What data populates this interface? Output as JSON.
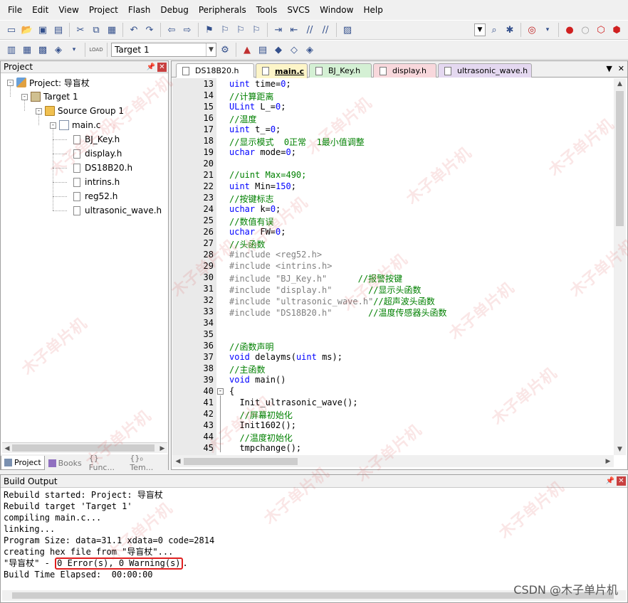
{
  "menu": [
    "File",
    "Edit",
    "View",
    "Project",
    "Flash",
    "Debug",
    "Peripherals",
    "Tools",
    "SVCS",
    "Window",
    "Help"
  ],
  "toolbar2": {
    "target_select": "Target 1",
    "load_label": "LOAD"
  },
  "project_panel": {
    "title": "Project",
    "tree": {
      "project": "Project: 导盲杖",
      "target": "Target 1",
      "group": "Source Group 1",
      "main_file": "main.c",
      "headers": [
        "BJ_Key.h",
        "display.h",
        "DS18B20.h",
        "intrins.h",
        "reg52.h",
        "ultrasonic_wave.h"
      ]
    },
    "tabs": [
      "Project",
      "Books",
      "{} Func...",
      "{}₀ Tem..."
    ]
  },
  "editor": {
    "tabs": [
      {
        "label": "DS18B20.h",
        "color": "#ffffff"
      },
      {
        "label": "main.c",
        "color": "#fdf5c8"
      },
      {
        "label": "BJ_Key.h",
        "color": "#d4f0d4"
      },
      {
        "label": "display.h",
        "color": "#f8d8dc"
      },
      {
        "label": "ultrasonic_wave.h",
        "color": "#e4d8f0"
      }
    ],
    "lines": [
      {
        "n": "13",
        "text": "uint time=0;"
      },
      {
        "n": "14",
        "text": "//计算距离"
      },
      {
        "n": "15",
        "text": "ULint L_=0;"
      },
      {
        "n": "16",
        "text": "//温度"
      },
      {
        "n": "17",
        "text": "uint t_=0;"
      },
      {
        "n": "18",
        "text": "//显示模式  0正常  1最小值调整"
      },
      {
        "n": "19",
        "text": "uchar mode=0;"
      },
      {
        "n": "20",
        "text": ""
      },
      {
        "n": "21",
        "text": "//uint Max=490;"
      },
      {
        "n": "22",
        "text": "uint Min=150;"
      },
      {
        "n": "23",
        "text": "//按键标志"
      },
      {
        "n": "24",
        "text": "uchar k=0;"
      },
      {
        "n": "25",
        "text": "//数值有误"
      },
      {
        "n": "26",
        "text": "uchar FW=0;"
      },
      {
        "n": "27",
        "text": "//头函数"
      },
      {
        "n": "28",
        "text": "#include <reg52.h>"
      },
      {
        "n": "29",
        "text": "#include <intrins.h>"
      },
      {
        "n": "30",
        "text": "#include \"BJ_Key.h\"      //报警按键"
      },
      {
        "n": "31",
        "text": "#include \"display.h\"       //显示头函数"
      },
      {
        "n": "32",
        "text": "#include \"ultrasonic_wave.h\"//超声波头函数"
      },
      {
        "n": "33",
        "text": "#include \"DS18B20.h\"       //温度传感器头函数"
      },
      {
        "n": "34",
        "text": ""
      },
      {
        "n": "35",
        "text": ""
      },
      {
        "n": "36",
        "text": "//函数声明"
      },
      {
        "n": "37",
        "text": "void delayms(uint ms);"
      },
      {
        "n": "38",
        "text": "//主函数"
      },
      {
        "n": "39",
        "text": "void main()"
      },
      {
        "n": "40",
        "text": "{"
      },
      {
        "n": "41",
        "text": "  Init_ultrasonic_wave();"
      },
      {
        "n": "42",
        "text": "  //屏幕初始化"
      },
      {
        "n": "43",
        "text": "  Init1602();"
      },
      {
        "n": "44",
        "text": "  //温度初始化"
      },
      {
        "n": "45",
        "text": "  tmpchange();"
      }
    ]
  },
  "build_output": {
    "title": "Build Output",
    "lines": [
      "Rebuild started: Project: 导盲杖",
      "Rebuild target 'Target 1'",
      "compiling main.c...",
      "linking...",
      "Program Size: data=31.1 xdata=0 code=2814",
      "creating hex file from \"导盲杖\"..."
    ],
    "result_prefix": "\"导盲杖\" - ",
    "result_highlight": "0 Error(s), 0 Warning(s)",
    "result_suffix": ".",
    "elapsed": "Build Time Elapsed:  00:00:00"
  },
  "watermark_text": "木子单片机",
  "csdn_credit": "CSDN @木子单片机",
  "colors": {
    "keyword": "#0000ff",
    "comment": "#008000",
    "preprocessor": "#808080",
    "number": "#0000ff",
    "highlight": "#e02020"
  }
}
